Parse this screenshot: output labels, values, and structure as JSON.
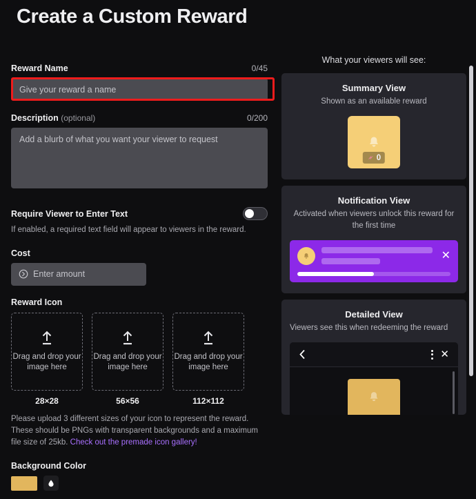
{
  "page": {
    "title": "Create a Custom Reward"
  },
  "form": {
    "reward_name": {
      "label": "Reward Name",
      "counter": "0/45",
      "placeholder": "Give your reward a name",
      "value": ""
    },
    "description": {
      "label": "Description",
      "optional": "(optional)",
      "counter": "0/200",
      "placeholder": "Add a blurb of what you want your viewer to request",
      "value": ""
    },
    "require_text": {
      "label": "Require Viewer to Enter Text",
      "help": "If enabled, a required text field will appear to viewers in the reward.",
      "state": "off"
    },
    "cost": {
      "label": "Cost",
      "placeholder": "Enter amount",
      "value": ""
    },
    "reward_icon": {
      "label": "Reward Icon",
      "uploaders": [
        {
          "text": "Drag and drop your image here",
          "dimension": "28×28"
        },
        {
          "text": "Drag and drop your image here",
          "dimension": "56×56"
        },
        {
          "text": "Drag and drop your image here",
          "dimension": "112×112"
        }
      ],
      "note_text": "Please upload 3 different sizes of your icon to represent the reward. These should be PNGs with transparent backgrounds and a maximum file size of 25kb. ",
      "note_link": "Check out the premade icon gallery!"
    },
    "background_color": {
      "label": "Background Color",
      "swatch": "#e2b65d"
    }
  },
  "preview": {
    "heading": "What your viewers will see:",
    "summary": {
      "title": "Summary View",
      "subtitle": "Shown as an available reward",
      "cost_value": "0"
    },
    "notification": {
      "title": "Notification View",
      "subtitle": "Activated when viewers unlock this reward for the first time",
      "progress_percent": 50,
      "accent": "#8c29e8"
    },
    "detailed": {
      "title": "Detailed View",
      "subtitle": "Viewers see this when redeeming the reward"
    }
  },
  "colors": {
    "background": "#0e0e10",
    "card": "#26262d",
    "input": "#4b4b51",
    "accent_purple": "#a970ff",
    "annotation_red": "#ee1c1c",
    "reward_yellow": "#f5cf77"
  }
}
